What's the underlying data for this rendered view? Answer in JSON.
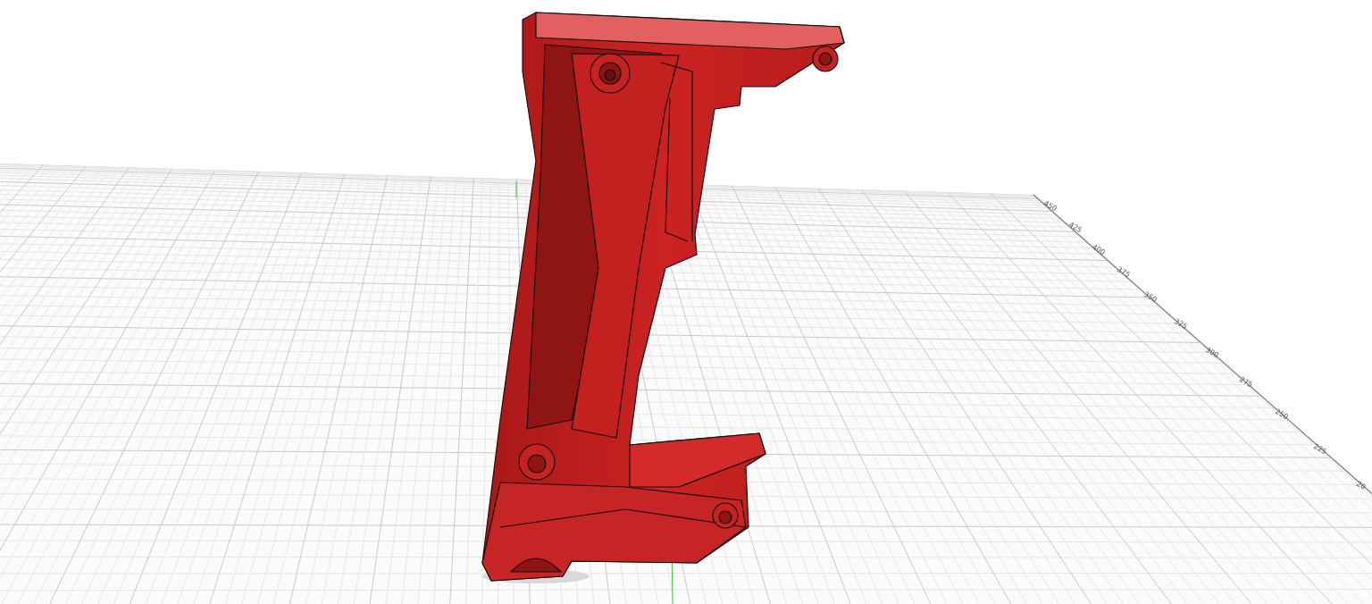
{
  "viewport": {
    "grid_labels": [
      "450",
      "425",
      "400",
      "375",
      "350",
      "325",
      "300",
      "275",
      "250",
      "225",
      "20"
    ]
  }
}
